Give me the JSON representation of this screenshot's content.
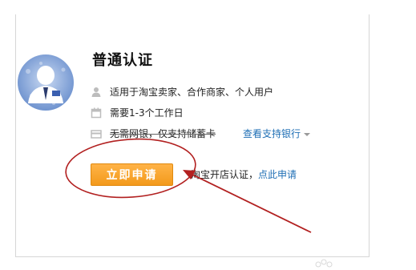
{
  "card": {
    "title": "普通认证",
    "avatar_icon": "user-avatar-icon",
    "requirements": [
      {
        "icon": "person-icon",
        "text": "适用于淘宝卖家、合作商家、个人用户"
      },
      {
        "icon": "calendar-icon",
        "text": "需要1-3个工作日"
      },
      {
        "icon": "card-icon",
        "text": "无需网银，仅支持储蓄卡"
      }
    ],
    "supported_banks_link": "查看支持银行",
    "apply_button": "立即申请",
    "note_prefix": "淘宝开店认证，",
    "note_link": "点此申请"
  },
  "colors": {
    "button": "#f39a1c",
    "link": "#1f6fb5",
    "annotation": "#b22020"
  }
}
